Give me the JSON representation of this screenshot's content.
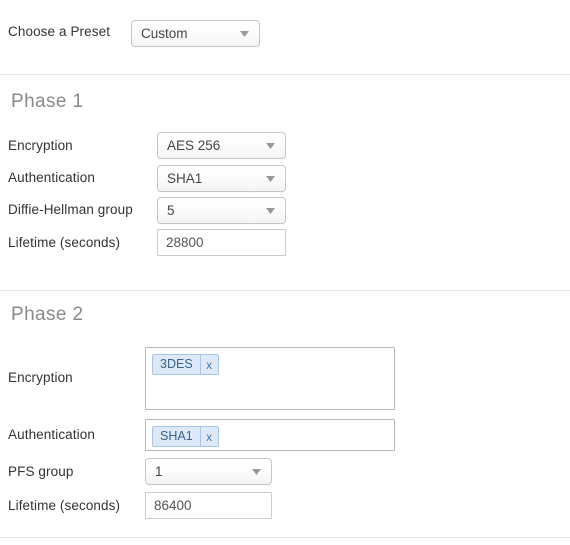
{
  "preset": {
    "label": "Choose a Preset",
    "value": "Custom",
    "caret_icon": "chevron-down-icon"
  },
  "phase1": {
    "heading": "Phase 1",
    "encryption": {
      "label": "Encryption",
      "value": "AES 256"
    },
    "authentication": {
      "label": "Authentication",
      "value": "SHA1"
    },
    "dh_group": {
      "label": "Diffie-Hellman group",
      "value": "5"
    },
    "lifetime": {
      "label": "Lifetime (seconds)",
      "value": "28800"
    }
  },
  "phase2": {
    "heading": "Phase 2",
    "encryption": {
      "label": "Encryption",
      "tokens": [
        {
          "label": "3DES",
          "remove": "x"
        }
      ]
    },
    "authentication": {
      "label": "Authentication",
      "tokens": [
        {
          "label": "SHA1",
          "remove": "x"
        }
      ]
    },
    "pfs_group": {
      "label": "PFS group",
      "value": "1"
    },
    "lifetime": {
      "label": "Lifetime (seconds)",
      "value": "86400"
    }
  },
  "colors": {
    "chip_bg": "#dde9f8",
    "chip_border": "#a9c6e8",
    "chip_text": "#3a6390",
    "heading": "#8a8a8a",
    "divider": "#e6e6e6"
  }
}
